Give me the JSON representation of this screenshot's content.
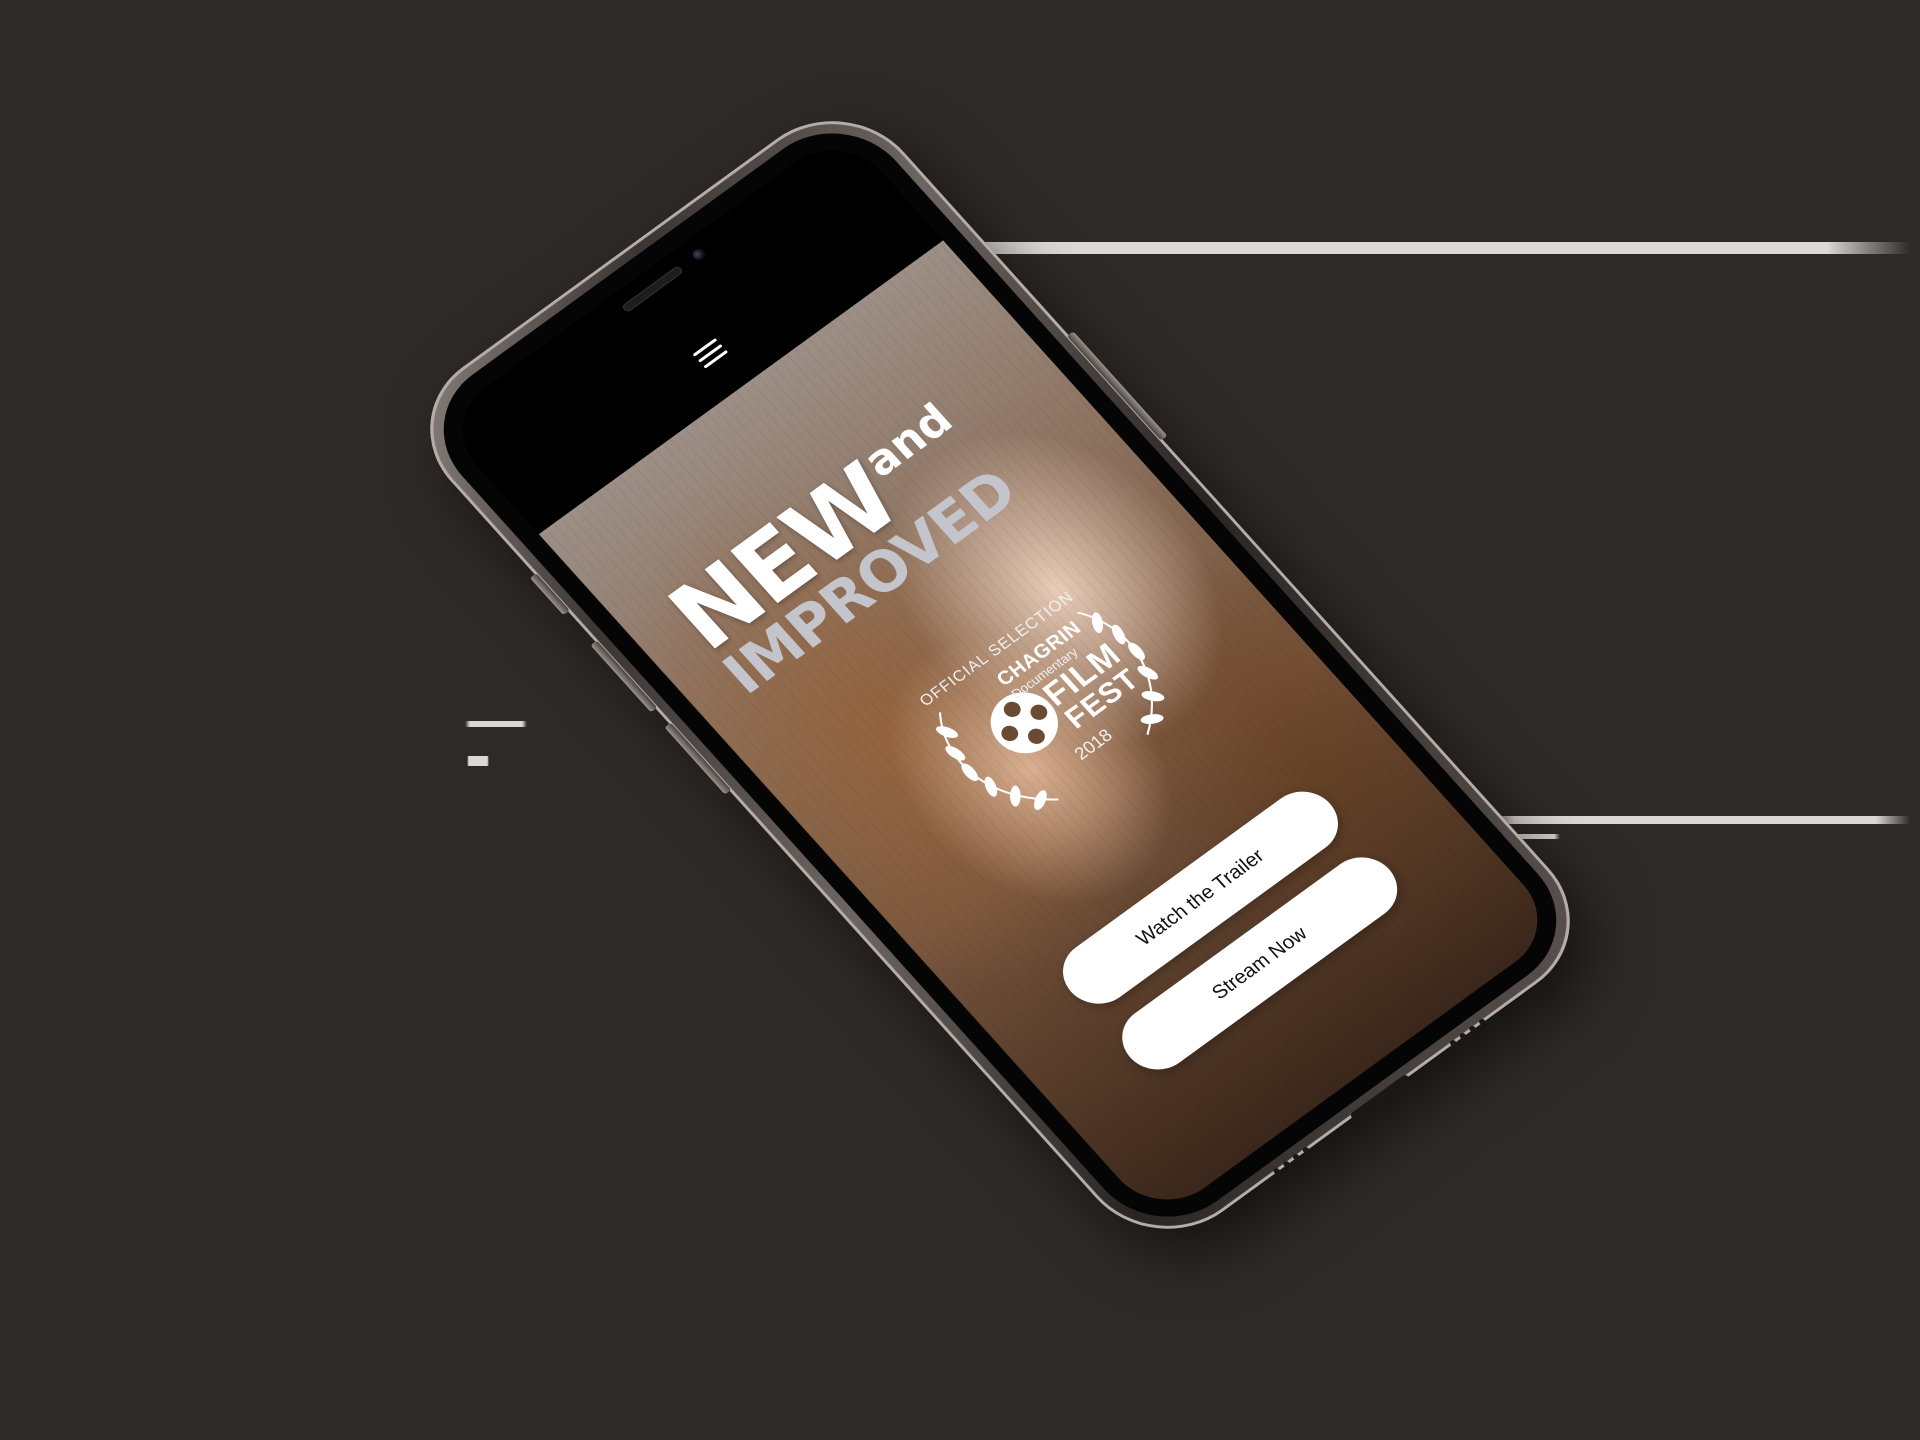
{
  "header": {
    "menu_icon": "hamburger-menu-icon"
  },
  "hero": {
    "title_new": "NEW",
    "title_and": "and",
    "title_improved": "IMPROVED"
  },
  "badge": {
    "official": "OFFICIAL SELECTION",
    "chagrin": "CHAGRIN",
    "documentary": "Documentary",
    "film": "FILM",
    "fest": "FEST",
    "year": "2018",
    "icon": "film-reel-icon"
  },
  "cta": {
    "trailer_label": "Watch the Trailer",
    "stream_label": "Stream Now"
  },
  "colors": {
    "background": "#2e2a27",
    "button_bg": "#ffffff",
    "improved_text": "#c4c4cc"
  }
}
